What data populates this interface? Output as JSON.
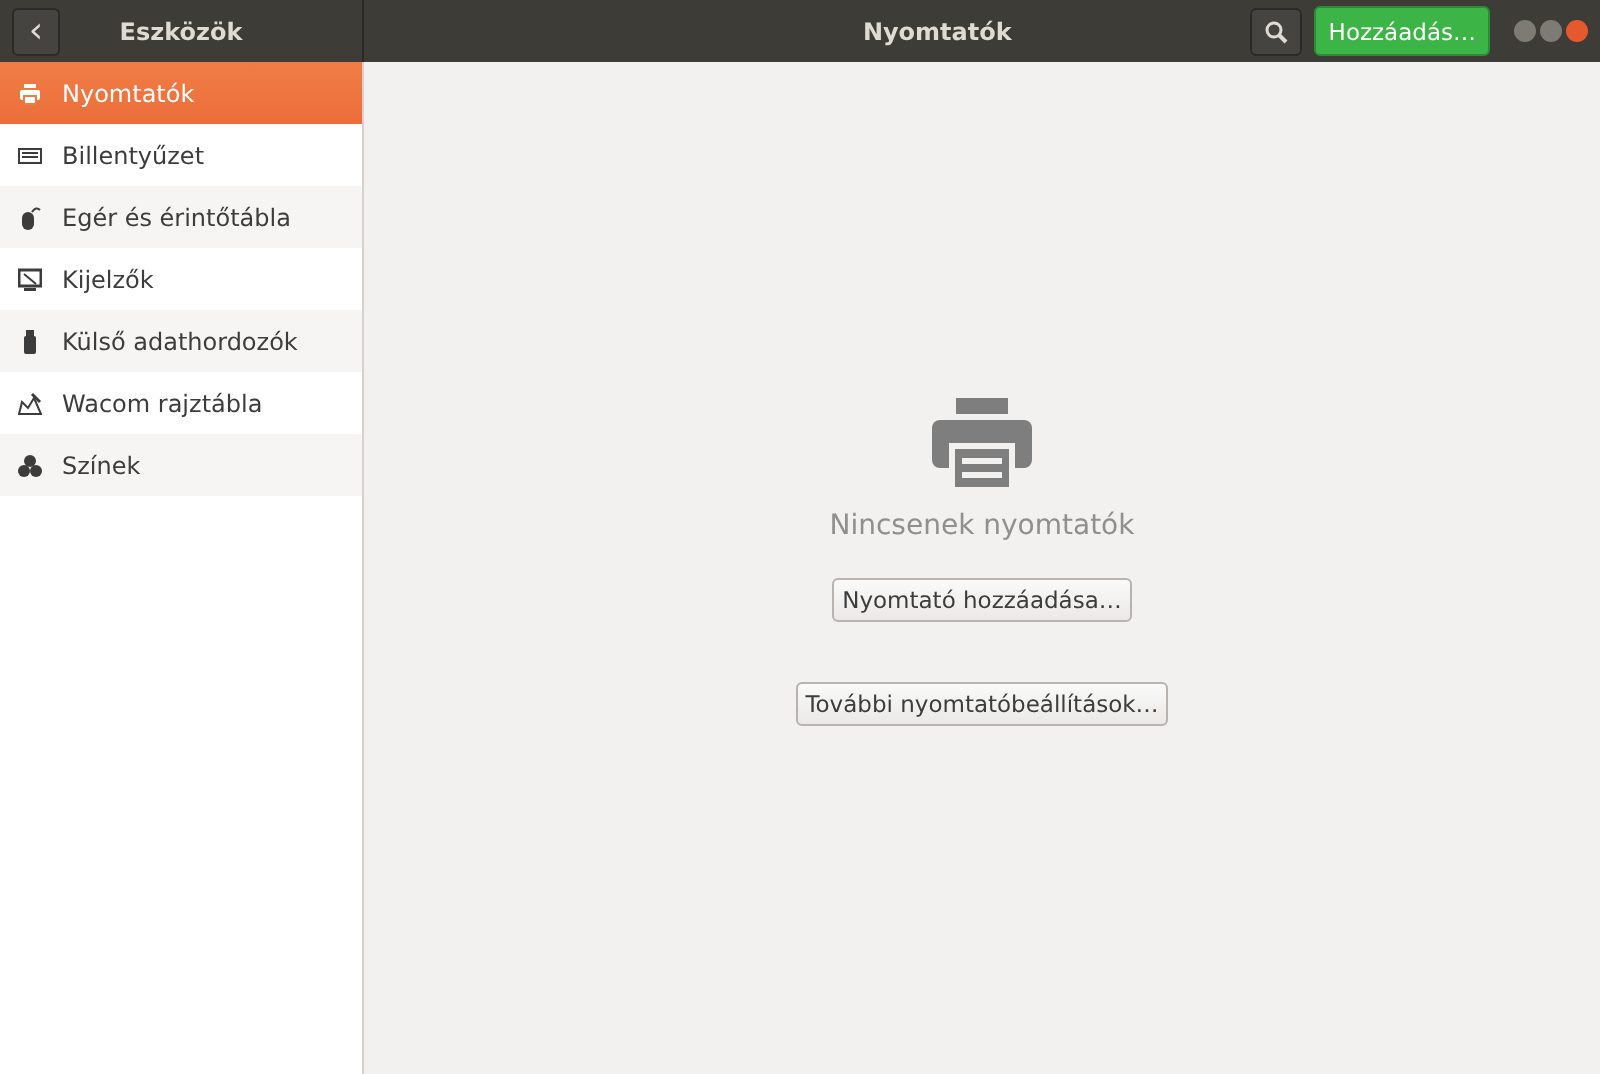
{
  "header": {
    "back_label": "‹",
    "sidebar_title": "Eszközök",
    "title": "Nyomtatók",
    "add_button": "Hozzáadás…"
  },
  "sidebar": {
    "items": [
      {
        "label": "Nyomtatók",
        "kind": "printer",
        "selected": true
      },
      {
        "label": "Billentyűzet",
        "kind": "keyboard",
        "selected": false
      },
      {
        "label": "Egér és érintőtábla",
        "kind": "mouse",
        "selected": false
      },
      {
        "label": "Kijelzők",
        "kind": "display",
        "selected": false
      },
      {
        "label": "Külső adathordozók",
        "kind": "usb",
        "selected": false
      },
      {
        "label": "Wacom rajztábla",
        "kind": "tablet",
        "selected": false
      },
      {
        "label": "Színek",
        "kind": "colors",
        "selected": false
      }
    ]
  },
  "content": {
    "empty_message": "Nincsenek nyomtatók",
    "add_printer_button": "Nyomtató hozzáadása…",
    "more_settings_button": "További nyomtatóbeállítások…"
  }
}
